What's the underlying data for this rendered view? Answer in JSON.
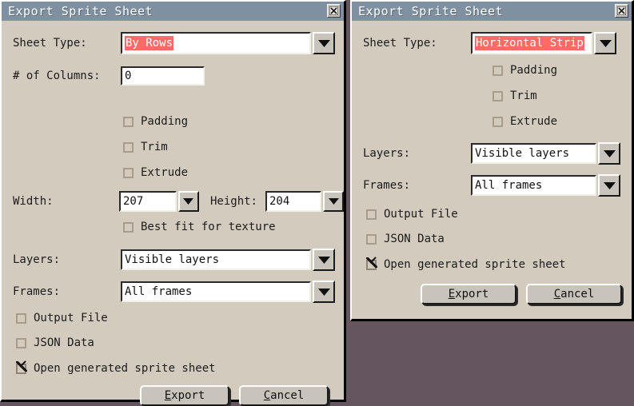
{
  "desktop": {
    "background_color": "#65555f"
  },
  "theme": {
    "titlebar_color": "#7f90a0",
    "dialog_face": "#d2cbbe",
    "button_face": "#c8c4bc",
    "selection_color": "#ff6a66",
    "selection_text_color": "#ffffff"
  },
  "dialog_left": {
    "title": "Export Sprite Sheet",
    "close_icon": "close-x-icon",
    "sheet_type": {
      "label": "Sheet Type:",
      "value": "By Rows",
      "selected": true,
      "dropdown_icon": "chevron-down-icon"
    },
    "columns": {
      "label": "# of Columns:",
      "value": "0"
    },
    "options": [
      {
        "label": "Padding",
        "checked": false
      },
      {
        "label": "Trim",
        "checked": false
      },
      {
        "label": "Extrude",
        "checked": false
      }
    ],
    "width": {
      "label": "Width:",
      "value": "207",
      "dropdown_icon": "chevron-down-icon"
    },
    "height": {
      "label": "Height:",
      "value": "204",
      "dropdown_icon": "chevron-down-icon"
    },
    "best_fit": {
      "label": "Best fit for texture",
      "checked": false
    },
    "layers": {
      "label": "Layers:",
      "value": "Visible layers",
      "dropdown_icon": "chevron-down-icon"
    },
    "frames": {
      "label": "Frames:",
      "value": "All frames",
      "dropdown_icon": "chevron-down-icon"
    },
    "output_options": [
      {
        "label": "Output File",
        "checked": false
      },
      {
        "label": "JSON Data",
        "checked": false
      },
      {
        "label": "Open generated sprite sheet",
        "checked": true
      }
    ],
    "buttons": {
      "export_mnemonic": "E",
      "export_rest": "xport",
      "cancel_mnemonic": "C",
      "cancel_rest": "ancel"
    }
  },
  "dialog_right": {
    "title": "Export Sprite Sheet",
    "close_icon": "close-x-icon",
    "sheet_type": {
      "label": "Sheet Type:",
      "value": "Horizontal Strip",
      "selected": true,
      "dropdown_icon": "chevron-down-icon"
    },
    "options": [
      {
        "label": "Padding",
        "checked": false
      },
      {
        "label": "Trim",
        "checked": false
      },
      {
        "label": "Extrude",
        "checked": false
      }
    ],
    "layers": {
      "label": "Layers:",
      "value": "Visible layers",
      "dropdown_icon": "chevron-down-icon"
    },
    "frames": {
      "label": "Frames:",
      "value": "All frames",
      "dropdown_icon": "chevron-down-icon"
    },
    "output_options": [
      {
        "label": "Output File",
        "checked": false
      },
      {
        "label": "JSON Data",
        "checked": false
      },
      {
        "label": "Open generated sprite sheet",
        "checked": true
      }
    ],
    "buttons": {
      "export_mnemonic": "E",
      "export_rest": "xport",
      "cancel_mnemonic": "C",
      "cancel_rest": "ancel"
    }
  }
}
